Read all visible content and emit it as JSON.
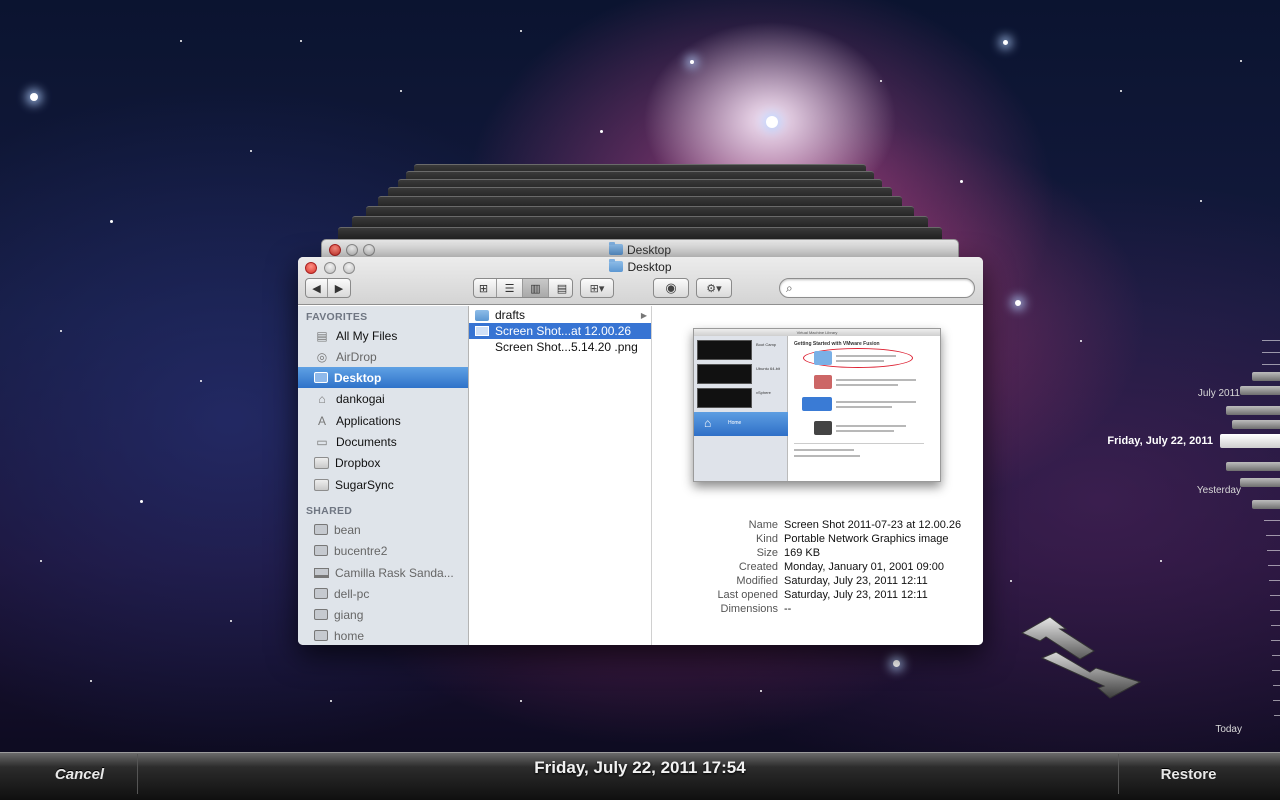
{
  "back_window": {
    "title": "Desktop"
  },
  "window": {
    "title": "Desktop",
    "search_placeholder": "",
    "toolbar": {
      "back_icon": "back-arrow-icon",
      "forward_icon": "forward-arrow-icon",
      "views": [
        "icon-view-icon",
        "list-view-icon",
        "column-view-icon",
        "coverflow-view-icon"
      ],
      "active_view": "column-view-icon",
      "arrange_icon": "arrange-icon",
      "quicklook_icon": "eye-icon",
      "action_icon": "gear-icon"
    }
  },
  "sidebar": {
    "favorites_header": "FAVORITES",
    "favorites": [
      {
        "label": "All My Files",
        "icon": "all-files-icon"
      },
      {
        "label": "AirDrop",
        "icon": "airdrop-icon"
      },
      {
        "label": "Desktop",
        "icon": "desktop-icon",
        "selected": true
      },
      {
        "label": "dankogai",
        "icon": "home-icon"
      },
      {
        "label": "Applications",
        "icon": "applications-icon"
      },
      {
        "label": "Documents",
        "icon": "documents-icon"
      },
      {
        "label": "Dropbox",
        "icon": "folder-icon"
      },
      {
        "label": "SugarSync",
        "icon": "folder-icon"
      }
    ],
    "shared_header": "SHARED",
    "shared": [
      {
        "label": "bean",
        "icon": "computer-icon"
      },
      {
        "label": "bucentre2",
        "icon": "computer-icon"
      },
      {
        "label": "Camilla Rask Sanda...",
        "icon": "laptop-icon"
      },
      {
        "label": "dell-pc",
        "icon": "computer-icon"
      },
      {
        "label": "giang",
        "icon": "computer-icon"
      },
      {
        "label": "home",
        "icon": "computer-icon"
      }
    ]
  },
  "files": [
    {
      "name": "drafts",
      "type": "folder"
    },
    {
      "name": "Screen Shot...at 12.00.26",
      "type": "image",
      "selected": true
    },
    {
      "name": "Screen Shot...5.14.20 .png",
      "type": "image"
    }
  ],
  "preview": {
    "thumbnail": {
      "window_title": "Virtual Machine Library",
      "heading": "Getting Started with VMware Fusion",
      "vms": [
        {
          "name": "Boot Camp",
          "status": "Powered off"
        },
        {
          "name": "Ubuntu 64-bit",
          "status": "Powered off"
        },
        {
          "name": "vSphere",
          "status": "Powered off"
        }
      ],
      "home_label": "Home"
    },
    "info": [
      {
        "key": "Name",
        "value": "Screen Shot 2011-07-23 at 12.00.26"
      },
      {
        "key": "Kind",
        "value": "Portable Network Graphics image"
      },
      {
        "key": "Size",
        "value": "169 KB"
      },
      {
        "key": "Created",
        "value": "Monday, January 01, 2001 09:00"
      },
      {
        "key": "Modified",
        "value": "Saturday, July 23, 2011 12:11"
      },
      {
        "key": "Last opened",
        "value": "Saturday, July 23, 2011 12:11"
      },
      {
        "key": "Dimensions",
        "value": "--"
      }
    ]
  },
  "timeline": {
    "label_month": "July 2011",
    "label_current": "Friday, July 22, 2011",
    "label_yesterday": "Yesterday",
    "label_today": "Today"
  },
  "bottombar": {
    "cancel": "Cancel",
    "date": "Friday, July 22, 2011 17:54",
    "restore": "Restore"
  },
  "nav": {
    "up_icon": "arrow-up-icon",
    "down_icon": "arrow-down-icon"
  }
}
